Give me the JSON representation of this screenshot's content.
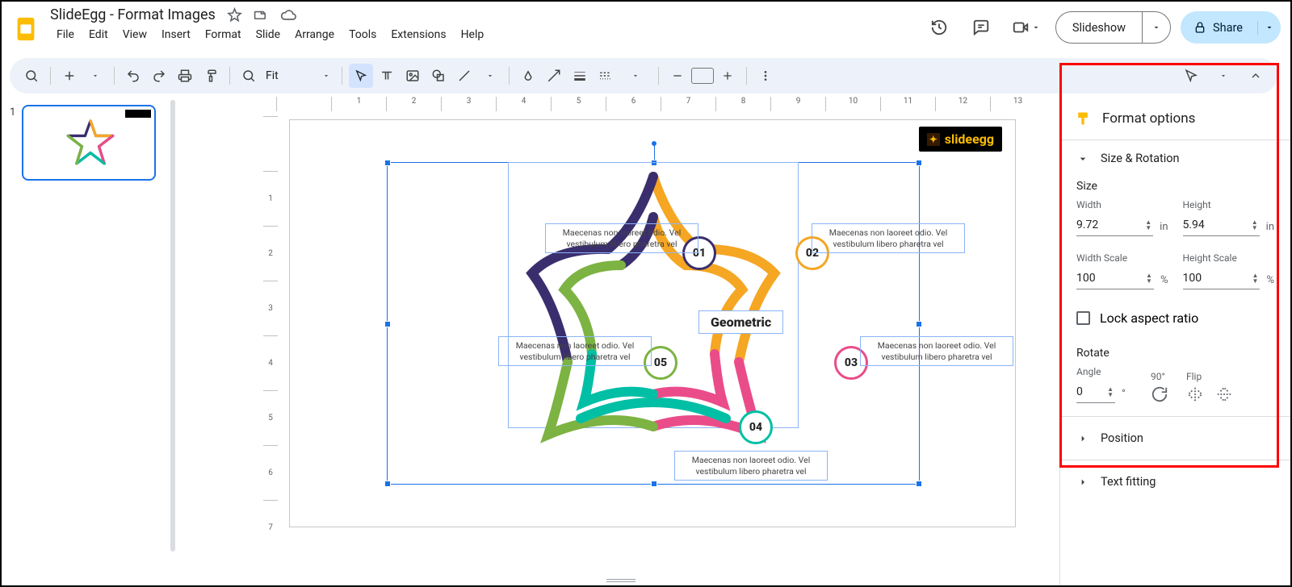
{
  "doc_title": "SlideEgg - Format Images",
  "menus": [
    "File",
    "Edit",
    "View",
    "Insert",
    "Format",
    "Slide",
    "Arrange",
    "Tools",
    "Extensions",
    "Help"
  ],
  "title_actions": {
    "slideshow": "Slideshow",
    "share": "Share"
  },
  "toolbar": {
    "zoom": "Fit"
  },
  "thumb": {
    "number": "1"
  },
  "ruler_h": [
    "",
    "1",
    "2",
    "3",
    "4",
    "5",
    "6",
    "7",
    "8",
    "9",
    "10",
    "11",
    "12",
    "13"
  ],
  "ruler_v": [
    "",
    "1",
    "2",
    "3",
    "4",
    "5",
    "6",
    "7"
  ],
  "slide": {
    "logo": "slideegg",
    "center": "Geometric",
    "nodes": [
      "01",
      "02",
      "03",
      "04",
      "05"
    ],
    "note": "Maecenas non laoreet odio. Vel vestibulum libero pharetra vel"
  },
  "panel": {
    "title": "Format options",
    "sec_size": "Size & Rotation",
    "size_h": "Size",
    "width_l": "Width",
    "width_v": "9.72",
    "height_l": "Height",
    "height_v": "5.94",
    "unit": "in",
    "wscale_l": "Width Scale",
    "wscale_v": "100",
    "hs_l": "Height Scale",
    "hs_v": "100",
    "pct": "%",
    "lock": "Lock aspect ratio",
    "rotate_h": "Rotate",
    "angle_l": "Angle",
    "angle_v": "0",
    "deg": "°",
    "ninety": "90°",
    "flip": "Flip",
    "position": "Position",
    "textfit": "Text fitting"
  }
}
